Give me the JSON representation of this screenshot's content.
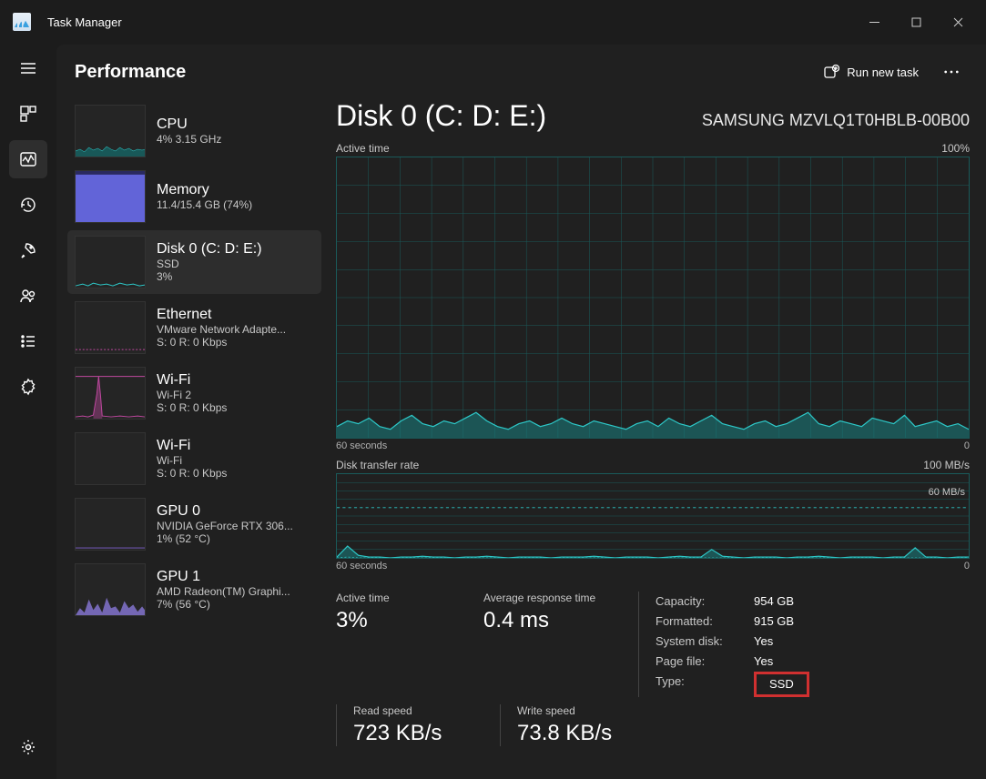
{
  "app": {
    "title": "Task Manager"
  },
  "page": {
    "title": "Performance",
    "run_task_label": "Run new task"
  },
  "sidebar": {
    "items": [
      {
        "name": "CPU",
        "sub": "4%  3.15 GHz"
      },
      {
        "name": "Memory",
        "sub": "11.4/15.4 GB (74%)"
      },
      {
        "name": "Disk 0 (C: D: E:)",
        "sub": "SSD",
        "sub2": "3%"
      },
      {
        "name": "Ethernet",
        "sub": "VMware Network Adapte...",
        "sub2": "S: 0  R: 0 Kbps"
      },
      {
        "name": "Wi-Fi",
        "sub": "Wi-Fi 2",
        "sub2": "S: 0  R: 0 Kbps"
      },
      {
        "name": "Wi-Fi",
        "sub": "Wi-Fi",
        "sub2": "S: 0  R: 0 Kbps"
      },
      {
        "name": "GPU 0",
        "sub": "NVIDIA GeForce RTX 306...",
        "sub2": "1%  (52 °C)"
      },
      {
        "name": "GPU 1",
        "sub": "AMD Radeon(TM) Graphi...",
        "sub2": "7%  (56 °C)"
      }
    ]
  },
  "main": {
    "title": "Disk 0 (C: D: E:)",
    "model": "SAMSUNG MZVLQ1T0HBLB-00B00",
    "chart1": {
      "label": "Active time",
      "max": "100%",
      "axis_left": "60 seconds",
      "axis_right": "0"
    },
    "chart2": {
      "label": "Disk transfer rate",
      "max": "100 MB/s",
      "ref": "60 MB/s",
      "axis_left": "60 seconds",
      "axis_right": "0"
    },
    "stats": {
      "active_time": {
        "label": "Active time",
        "value": "3%"
      },
      "avg_resp": {
        "label": "Average response time",
        "value": "0.4 ms"
      },
      "read_speed": {
        "label": "Read speed",
        "value": "723 KB/s"
      },
      "write_speed": {
        "label": "Write speed",
        "value": "73.8 KB/s"
      }
    },
    "props": {
      "capacity": {
        "label": "Capacity:",
        "value": "954 GB"
      },
      "formatted": {
        "label": "Formatted:",
        "value": "915 GB"
      },
      "sysdisk": {
        "label": "System disk:",
        "value": "Yes"
      },
      "pagefile": {
        "label": "Page file:",
        "value": "Yes"
      },
      "type": {
        "label": "Type:",
        "value": "SSD"
      }
    }
  },
  "chart_data": [
    {
      "type": "area",
      "title": "Active time",
      "ylabel": "Active time (%)",
      "ylim": [
        0,
        100
      ],
      "x_range_seconds": [
        60,
        0
      ],
      "values_pct": [
        4,
        6,
        5,
        7,
        4,
        3,
        6,
        8,
        5,
        4,
        6,
        5,
        7,
        9,
        6,
        4,
        3,
        5,
        6,
        4,
        5,
        7,
        5,
        4,
        6,
        5,
        4,
        3,
        5,
        6,
        4,
        7,
        5,
        4,
        6,
        8,
        5,
        4,
        3,
        5,
        6,
        4,
        5,
        7,
        9,
        5,
        4,
        6,
        5,
        4,
        7,
        6,
        5,
        8,
        4,
        5,
        6,
        4,
        5,
        3
      ]
    },
    {
      "type": "area",
      "title": "Disk transfer rate",
      "ylabel": "MB/s",
      "ylim": [
        0,
        100
      ],
      "x_range_seconds": [
        60,
        0
      ],
      "reference_lines_mb_s": [
        60
      ],
      "series": [
        {
          "name": "Read",
          "values_mb_s": [
            1,
            14,
            3,
            1,
            1,
            0,
            1,
            1,
            2,
            1,
            1,
            0,
            1,
            1,
            2,
            1,
            0,
            1,
            1,
            1,
            0,
            1,
            1,
            1,
            2,
            1,
            0,
            1,
            1,
            1,
            0,
            1,
            2,
            1,
            1,
            10,
            2,
            1,
            0,
            1,
            1,
            1,
            0,
            1,
            1,
            2,
            1,
            0,
            1,
            1,
            1,
            0,
            1,
            1,
            12,
            1,
            1,
            0,
            1,
            1
          ]
        },
        {
          "name": "Write",
          "values_mb_s": [
            0,
            1,
            0,
            0,
            0,
            0,
            0,
            0,
            0,
            0,
            0,
            0,
            0,
            0,
            0,
            0,
            0,
            0,
            0,
            0,
            0,
            0,
            0,
            0,
            0,
            0,
            0,
            0,
            0,
            0,
            0,
            0,
            0,
            0,
            0,
            0,
            0,
            0,
            0,
            0,
            0,
            0,
            0,
            0,
            0,
            0,
            0,
            0,
            0,
            0,
            0,
            0,
            0,
            0,
            0,
            0,
            0,
            0,
            0,
            0
          ]
        }
      ]
    }
  ]
}
